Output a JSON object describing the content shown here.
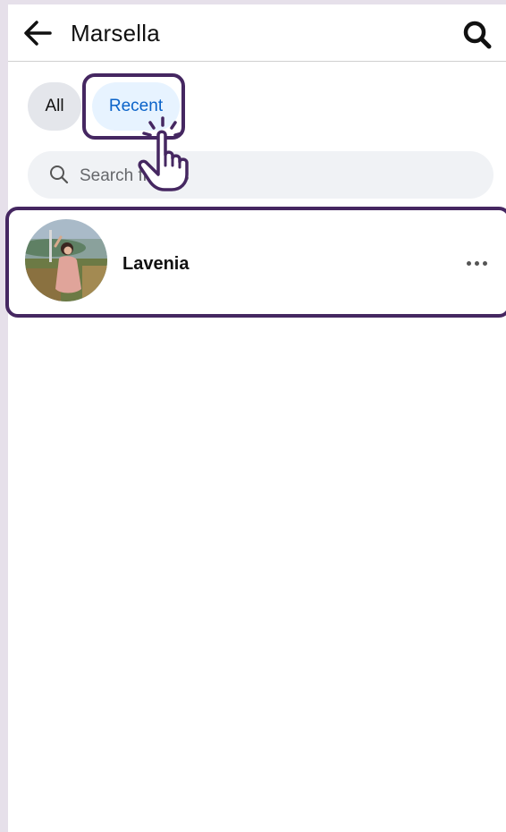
{
  "header": {
    "title": "Marsella",
    "back_icon": "arrow-left-icon",
    "search_icon": "search-icon"
  },
  "filters": {
    "chips": [
      {
        "label": "All",
        "selected": false
      },
      {
        "label": "Recent",
        "selected": true
      }
    ]
  },
  "search": {
    "placeholder": "Search friends",
    "value": "",
    "icon": "search-icon"
  },
  "friends": [
    {
      "name": "Lavenia",
      "avatar_icon": "avatar-photo",
      "menu_icon": "more-horizontal-icon"
    }
  ],
  "colors": {
    "highlight": "#452761",
    "accent": "#0b63c9",
    "chip_selected_bg": "#e7f3ff",
    "chip_bg": "#e4e6eb",
    "search_bg": "#f0f2f5"
  }
}
